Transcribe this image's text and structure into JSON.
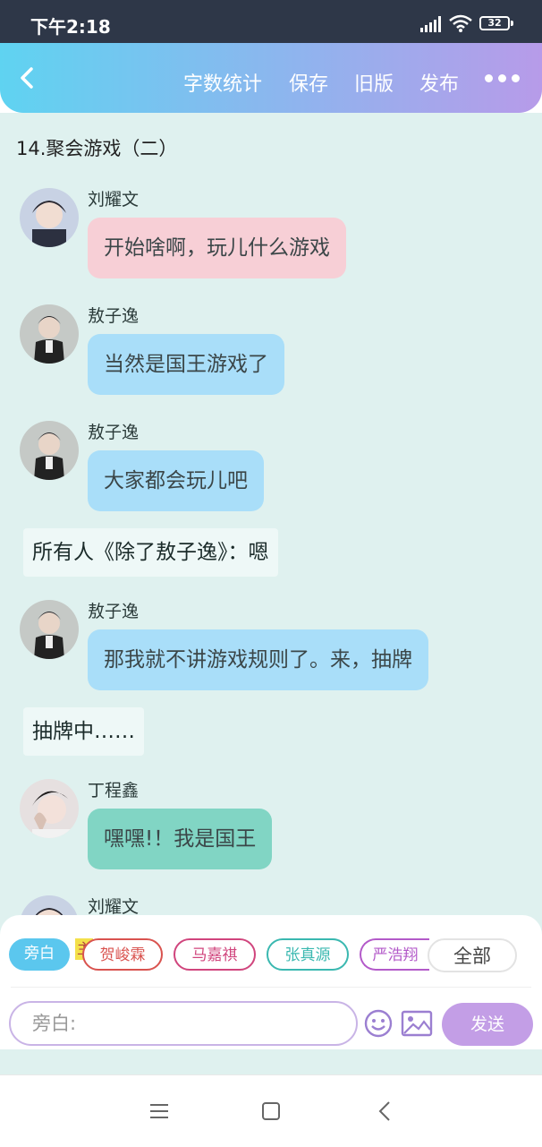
{
  "status_bar": {
    "time": "下午2:18",
    "battery": "32"
  },
  "nav": {
    "items": [
      "字数统计",
      "保存",
      "旧版",
      "发布"
    ]
  },
  "chapter_title": "14.聚会游戏（二）",
  "messages": [
    {
      "type": "chat",
      "sender": "刘耀文",
      "text": "开始啥啊，玩儿什么游戏",
      "color": "#f7cfd6"
    },
    {
      "type": "chat",
      "sender": "敖子逸",
      "text": "当然是国王游戏了",
      "color": "#a9def9"
    },
    {
      "type": "chat",
      "sender": "敖子逸",
      "text": "大家都会玩儿吧",
      "color": "#a9def9"
    },
    {
      "type": "narration",
      "text": "所有人《除了敖子逸》：嗯"
    },
    {
      "type": "chat",
      "sender": "敖子逸",
      "text": "那我就不讲游戏规则了。来，抽牌",
      "color": "#a9def9"
    },
    {
      "type": "narration",
      "text": "抽牌中……"
    },
    {
      "type": "chat",
      "sender": "丁程鑫",
      "text": "嘿嘿!！我是国王",
      "color": "#81d5c4"
    },
    {
      "type": "chat",
      "sender": "刘耀文",
      "text": ""
    }
  ],
  "composer": {
    "chips": [
      {
        "label": "旁白",
        "color": "#5bc7ee"
      },
      {
        "label": "贺峻霖",
        "color": "#d9534f"
      },
      {
        "label": "马嘉祺",
        "color": "#d0457d"
      },
      {
        "label": "张真源",
        "color": "#3ab8b0"
      },
      {
        "label": "严浩翔",
        "color": "#b35ac9"
      }
    ],
    "host_mark": "主",
    "all_label": "全部",
    "input_placeholder": "旁白:",
    "send_label": "发送"
  }
}
